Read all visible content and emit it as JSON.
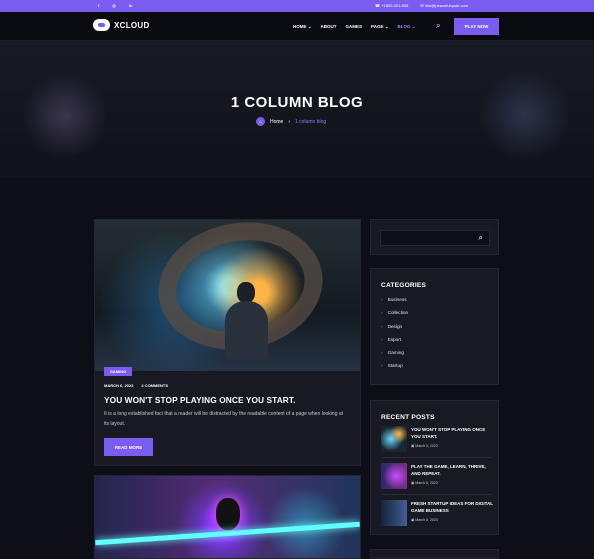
{
  "topbar": {
    "social": [
      "f",
      "◎",
      "in"
    ],
    "phone": "+1800-001-658",
    "email": "info@peacefulqode.com"
  },
  "header": {
    "logo_text": "XCLOUD",
    "nav": [
      "HOME ⌄",
      "ABOUT",
      "GAMES",
      "PAGE ⌄",
      "BLOG ⌄"
    ],
    "play_button": "PLAY NOW",
    "icons": [
      "gamepad-logo-icon",
      "search-icon",
      "phone-icon",
      "mail-icon"
    ]
  },
  "hero": {
    "title": "1 COLUMN BLOG",
    "breadcrumb_home": "Home",
    "breadcrumb_separator": "›",
    "breadcrumb_current": "1 column blog"
  },
  "post": {
    "category": "GAMING",
    "date": "MARCH 6, 2023",
    "comments": "2 COMMENTS",
    "title": "YOU WON'T STOP PLAYING ONCE YOU START.",
    "excerpt": "It is a long established fact that a reader will be distracted by the readable content of a page when looking at its layout.",
    "read_more": "READ MORE"
  },
  "sidebar": {
    "categories_title": "CATEGORIES",
    "categories": [
      "Business",
      "Collection",
      "Design",
      "Esport",
      "Gaming",
      "Startup"
    ],
    "recent_title": "RECENT POSTS",
    "recent_posts": [
      {
        "title": "YOU WON'T STOP PLAYING ONCE YOU START.",
        "date": "March 5, 2023"
      },
      {
        "title": "PLAY THE GAME, LEARN, THRIVE, AND REPEAT.",
        "date": "March 5, 2023"
      },
      {
        "title": "FRESH STARTUP IDEAS FOR DIGITAL GAME BUSINESS",
        "date": "March 5, 2023"
      }
    ]
  },
  "colors": {
    "accent": "#7b5cf0",
    "background": "#0e0f16",
    "card": "#181922"
  }
}
